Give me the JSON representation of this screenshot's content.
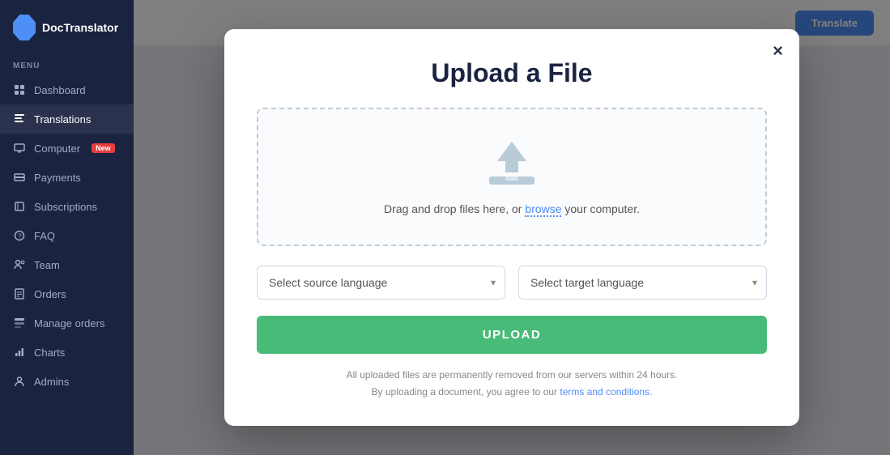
{
  "sidebar": {
    "logo_text": "DocTranslator",
    "menu_label": "MENU",
    "items": [
      {
        "id": "dashboard",
        "label": "Dashboard",
        "icon": "🏠",
        "active": false
      },
      {
        "id": "translations",
        "label": "Translations",
        "icon": "📄",
        "active": true
      },
      {
        "id": "computer",
        "label": "Computer",
        "icon": "💻",
        "active": false,
        "badge": "New"
      },
      {
        "id": "payments",
        "label": "Payments",
        "icon": "💳",
        "active": false
      },
      {
        "id": "subscriptions",
        "label": "Subscriptions",
        "icon": "📦",
        "active": false
      },
      {
        "id": "faq",
        "label": "FAQ",
        "icon": "❓",
        "active": false
      },
      {
        "id": "team",
        "label": "Team",
        "icon": "👥",
        "active": false
      },
      {
        "id": "orders",
        "label": "Orders",
        "icon": "📋",
        "active": false
      },
      {
        "id": "manage-orders",
        "label": "Manage orders",
        "icon": "🗂",
        "active": false
      },
      {
        "id": "charts",
        "label": "Charts",
        "icon": "📊",
        "active": false
      },
      {
        "id": "admins",
        "label": "Admins",
        "icon": "🔒",
        "active": false
      }
    ]
  },
  "topbar": {
    "translate_btn_label": "Translate"
  },
  "modal": {
    "title": "Upload a File",
    "close_label": "×",
    "dropzone": {
      "text_before_link": "Drag and drop files here, or ",
      "link_text": "browse",
      "text_after_link": " your computer."
    },
    "source_language_placeholder": "Select source language",
    "target_language_placeholder": "Select target language",
    "upload_btn_label": "UPLOAD",
    "footer_line1": "All uploaded files are permanently removed from our servers within 24 hours.",
    "footer_line2_before": "By uploading a document, you agree to our ",
    "footer_tc_link": "terms and conditions",
    "footer_line2_after": ".",
    "colors": {
      "upload_btn_bg": "#48bb78",
      "browse_link": "#4e8ef7",
      "title": "#1a2340"
    }
  }
}
